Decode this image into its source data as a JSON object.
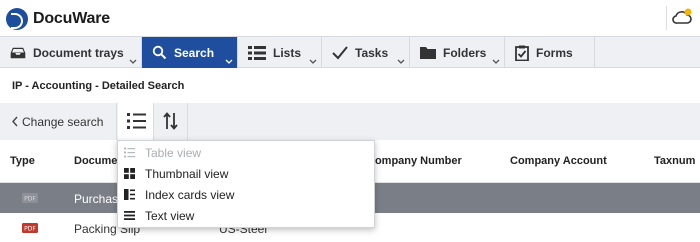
{
  "app": {
    "name": "DocuWare"
  },
  "nav": {
    "tabs": [
      {
        "label": "Document trays",
        "icon": "tray-icon"
      },
      {
        "label": "Search",
        "icon": "search-icon",
        "active": true
      },
      {
        "label": "Lists",
        "icon": "list-icon"
      },
      {
        "label": "Tasks",
        "icon": "checkmark-icon"
      },
      {
        "label": "Folders",
        "icon": "folder-icon"
      },
      {
        "label": "Forms",
        "icon": "form-icon"
      }
    ]
  },
  "page": {
    "title": "IP - Accounting - Detailed Search"
  },
  "toolbar": {
    "change_search": "Change search"
  },
  "table": {
    "headers": {
      "type": "Type",
      "document": "Document",
      "company_number": "Company Number",
      "company_account": "Company Account",
      "taxnum": "Taxnum"
    },
    "rows": [
      {
        "type": "PDF",
        "document": "Purchase",
        "company": "",
        "selected": true
      },
      {
        "type": "PDF",
        "document": "Packing Slip",
        "company": "US-Steel",
        "selected": false
      }
    ]
  },
  "view_menu": {
    "items": [
      {
        "label": "Table view",
        "icon": "table-view-icon",
        "disabled": true
      },
      {
        "label": "Thumbnail view",
        "icon": "thumbnail-view-icon",
        "disabled": false
      },
      {
        "label": "Index cards view",
        "icon": "index-cards-icon",
        "disabled": false
      },
      {
        "label": "Text view",
        "icon": "text-view-icon",
        "disabled": false
      }
    ]
  },
  "colors": {
    "brand_blue": "#1f4e9f",
    "nav_bg": "#eef0f3",
    "selected_row": "#7a7f87",
    "pdf_red": "#c0392b",
    "notification_dot": "#f2b705"
  }
}
